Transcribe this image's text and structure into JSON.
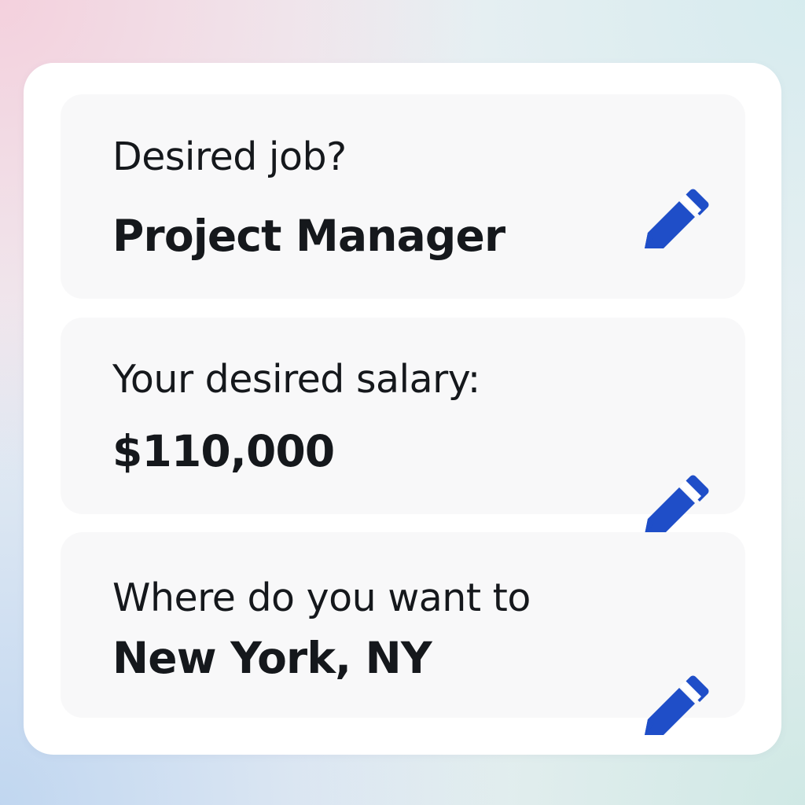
{
  "colors": {
    "accent": "#1f4ec8",
    "text": "#15181c",
    "card": "#ffffff",
    "row": "#f8f8f9"
  },
  "fields": [
    {
      "question": "Desired job?",
      "answer": "Project Manager",
      "action_icon": "pencil-icon"
    },
    {
      "question": "Your desired salary:",
      "answer": "$110,000",
      "action_icon": "pencil-icon"
    },
    {
      "question": "Where do you want to",
      "answer": "New York, NY",
      "action_icon": "pencil-icon"
    }
  ]
}
